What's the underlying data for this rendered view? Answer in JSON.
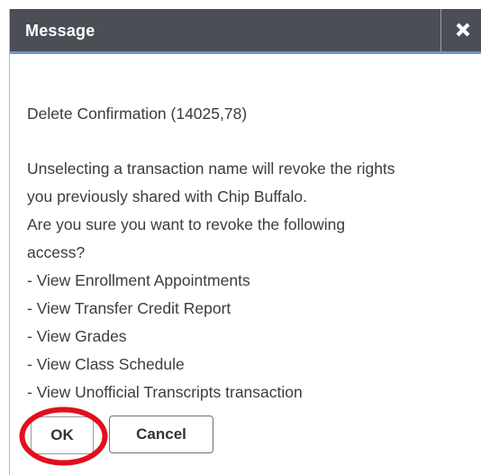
{
  "dialog": {
    "title": "Message",
    "close_icon": "close-x-icon",
    "heading": "Delete Confirmation (14025,78)",
    "body_lines": [
      "Unselecting a transaction name will revoke the rights",
      "you previously shared with Chip Buffalo.",
      "Are you sure you want to revoke the following",
      "access?"
    ],
    "access_items": [
      "- View Enrollment Appointments",
      "- View Transfer Credit Report",
      "- View Grades",
      "- View Class Schedule",
      "- View Unofficial Transcripts transaction"
    ],
    "ok_label": "OK",
    "cancel_label": "Cancel"
  },
  "colors": {
    "titlebar": "#4b4f55",
    "titlebar_accent": "#6f93cf",
    "highlight": "#e0101c",
    "text": "#3c3c3c"
  }
}
